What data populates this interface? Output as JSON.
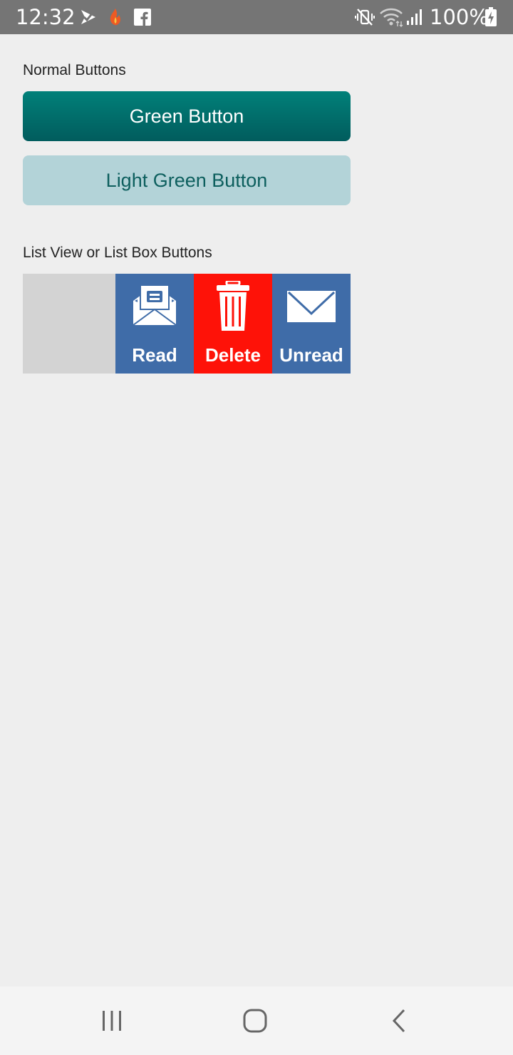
{
  "status_bar": {
    "time": "12:32",
    "battery_percent": "100%",
    "icons": [
      "check-notification-icon",
      "flame-app-icon",
      "facebook-icon",
      "mute-vibrate-icon",
      "wifi-icon",
      "signal-icon",
      "battery-charging-icon"
    ]
  },
  "normal_section": {
    "label": "Normal Buttons",
    "green_button": "Green Button",
    "light_green_button": "Light Green Button"
  },
  "list_section": {
    "label": "List View or List Box Buttons",
    "actions": [
      {
        "label": "Read",
        "icon": "open-envelope-icon",
        "color": "#3f6ca8"
      },
      {
        "label": "Delete",
        "icon": "trash-icon",
        "color": "#fe1208"
      },
      {
        "label": "Unread",
        "icon": "envelope-icon",
        "color": "#3f6ca8"
      }
    ]
  },
  "colors": {
    "green_top": "#018079",
    "green_bottom": "#015c5d",
    "light_green": "#b3d3d8",
    "light_green_text": "#0d5f5e",
    "list_item_bg": "#d3d3d3",
    "page_bg": "#eeeeee"
  },
  "nav_bar": {
    "icons": [
      "recent-apps-icon",
      "home-icon",
      "back-icon"
    ]
  }
}
